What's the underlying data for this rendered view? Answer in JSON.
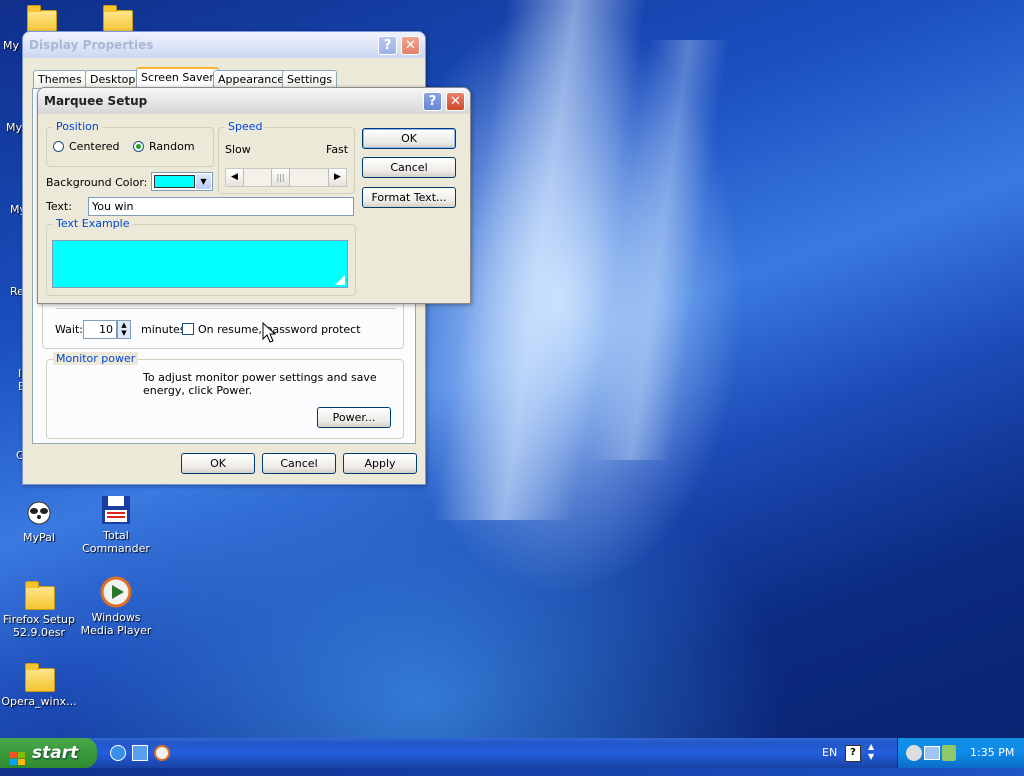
{
  "desktop": {
    "icons": [
      {
        "label": "MyPal"
      },
      {
        "label": "Total Commander"
      },
      {
        "label": "Firefox Setup 52.9.0esr"
      },
      {
        "label": "Windows Media Player"
      },
      {
        "label": "Opera_winx..."
      }
    ],
    "edge_labels": [
      "My",
      "My",
      "My",
      "Re",
      "I",
      "E",
      "C"
    ]
  },
  "display_properties": {
    "title": "Display Properties",
    "tabs": [
      "Themes",
      "Desktop",
      "Screen Saver",
      "Appearance",
      "Settings"
    ],
    "selected_tab": "Screen Saver",
    "wait_label": "Wait:",
    "wait_value": "10",
    "minutes_label": "minutes",
    "resume_label": "On resume, password protect",
    "monitor_power": {
      "legend": "Monitor power",
      "text": "To adjust monitor power settings and save energy, click Power.",
      "power_button": "Power..."
    },
    "buttons": {
      "ok": "OK",
      "cancel": "Cancel",
      "apply": "Apply"
    }
  },
  "marquee_setup": {
    "title": "Marquee Setup",
    "position": {
      "legend": "Position",
      "centered": "Centered",
      "random": "Random",
      "selected": "Random"
    },
    "speed": {
      "legend": "Speed",
      "slow": "Slow",
      "fast": "Fast",
      "level": 0.4
    },
    "background_color_label": "Background Color:",
    "background_color": "#00ffff",
    "text_label": "Text:",
    "text_value": "You win",
    "text_example_legend": "Text Example",
    "buttons": {
      "ok": "OK",
      "cancel": "Cancel",
      "format_text": "Format Text..."
    }
  },
  "taskbar": {
    "start_label": "start",
    "language": "EN",
    "clock": "1:35 PM"
  },
  "colors": {
    "xp_blue": "#0831d9",
    "start_green": "#3c9a3c",
    "cyan": "#00ffff"
  }
}
